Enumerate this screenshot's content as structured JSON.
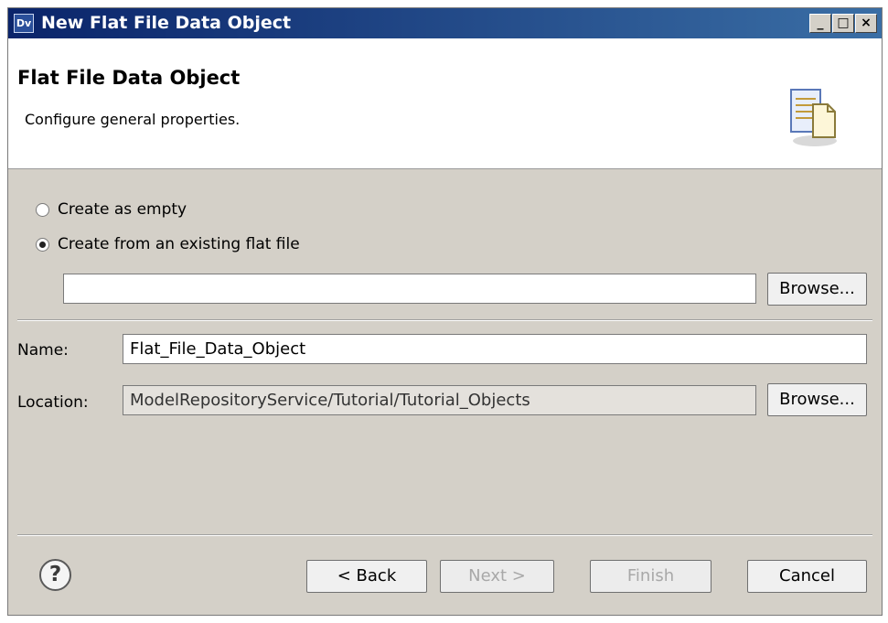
{
  "window": {
    "app_icon_label": "Dv",
    "title": "New Flat File Data Object",
    "buttons": {
      "minimize": "_",
      "maximize": "□",
      "close": "×"
    }
  },
  "header": {
    "title": "Flat File Data Object",
    "description": "Configure general properties."
  },
  "options": [
    {
      "label": "Create as empty",
      "selected": false
    },
    {
      "label": "Create from an existing flat file",
      "selected": true
    }
  ],
  "file_path": {
    "value": ""
  },
  "browse_label": "Browse...",
  "name_field": {
    "label": "Name:",
    "value": "Flat_File_Data_Object"
  },
  "location_field": {
    "label": "Location:",
    "value": "ModelRepositoryService/Tutorial/Tutorial_Objects"
  },
  "footer": {
    "help": "?",
    "back": "< Back",
    "next": "Next >",
    "finish": "Finish",
    "cancel": "Cancel"
  },
  "colors": {
    "title_bar": "#0a246a",
    "dialog_bg": "#d4d0c8"
  }
}
